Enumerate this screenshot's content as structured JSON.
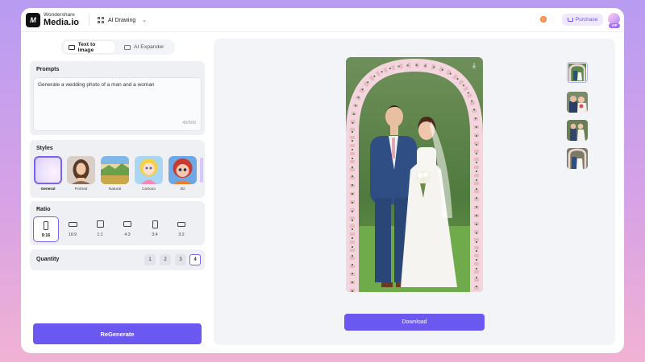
{
  "header": {
    "brand_top": "Wondershare",
    "brand_main": "Media.io",
    "logo_text": "M",
    "nav_label": "AI Drawing",
    "purchase_label": "Purchase",
    "vip_label": "VIP"
  },
  "mode_tabs": [
    {
      "label": "Text to Image",
      "active": true
    },
    {
      "label": "AI Expander",
      "active": false
    }
  ],
  "prompts": {
    "title": "Prompts",
    "value": "Generate a wedding photo of a man and a woman",
    "count": "45/500"
  },
  "styles": {
    "title": "Styles",
    "items": [
      {
        "label": "General",
        "active": true
      },
      {
        "label": "Portrait",
        "active": false
      },
      {
        "label": "Natural",
        "active": false
      },
      {
        "label": "Cartoon",
        "active": false
      },
      {
        "label": "3D",
        "active": false
      }
    ]
  },
  "ratio": {
    "title": "Ratio",
    "items": [
      {
        "label": "9:16",
        "active": true
      },
      {
        "label": "16:9",
        "active": false
      },
      {
        "label": "1:1",
        "active": false
      },
      {
        "label": "4:3",
        "active": false
      },
      {
        "label": "3:4",
        "active": false
      },
      {
        "label": "3:2",
        "active": false
      }
    ]
  },
  "quantity": {
    "title": "Quantity",
    "options": [
      "1",
      "2",
      "3",
      "4"
    ],
    "selected": "4"
  },
  "actions": {
    "regenerate_label": "ReGenerate",
    "download_label": "Download"
  },
  "colors": {
    "accent": "#6a58f0",
    "selection_border": "#7a63f0",
    "background_top": "#b89cf2",
    "background_bottom": "#f1b2d3"
  }
}
